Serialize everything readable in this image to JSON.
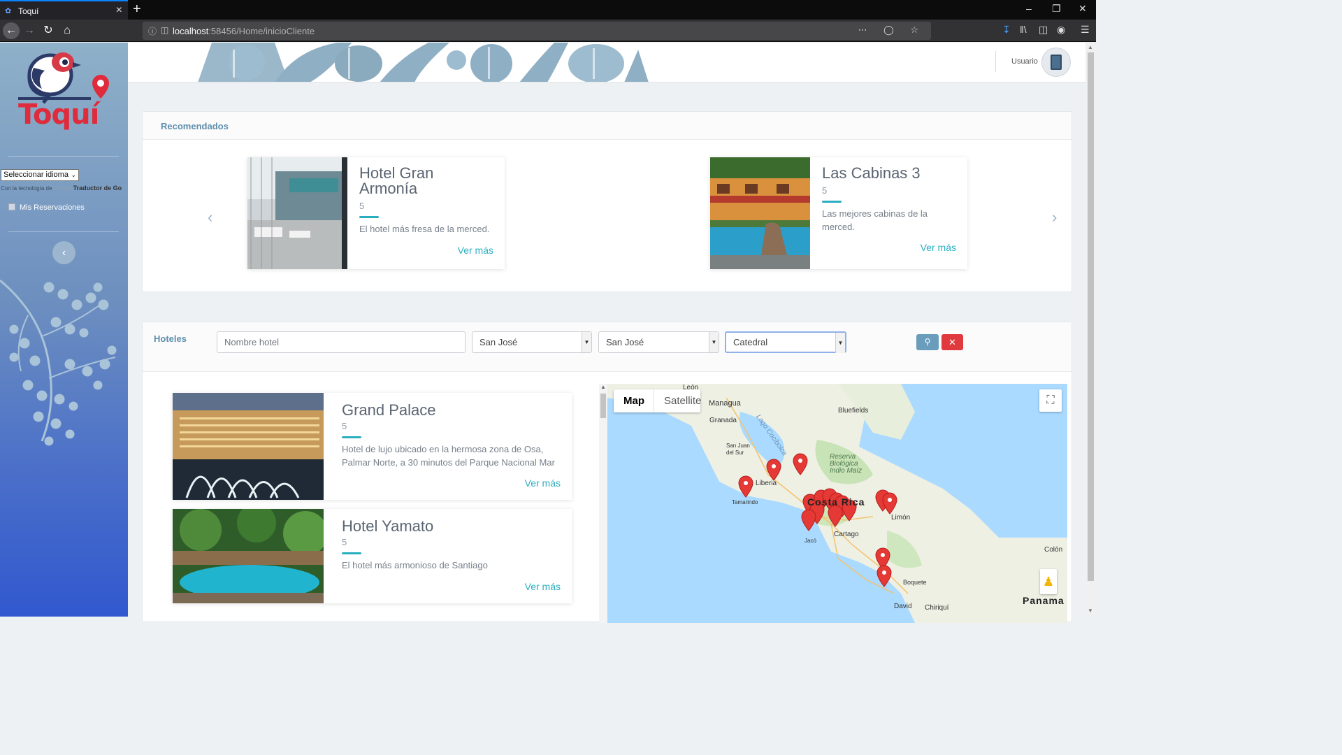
{
  "browser": {
    "tab_title": "Toquí",
    "url_host": "localhost",
    "url_rest": ":58456/Home/inicioCliente"
  },
  "sidebar": {
    "logo_text": "Toquí",
    "language_select": "Seleccionar idioma",
    "powered_prefix": "Con la tecnología de",
    "powered_google": "Google",
    "powered_suffix": "Traductor de Go",
    "menu_item": "Mis Reservaciones"
  },
  "header": {
    "user_label": "Usuario"
  },
  "recommended": {
    "title": "Recomendados",
    "items": [
      {
        "name_line1": "Hotel Gran",
        "name_line2": "Armonía",
        "rating": "5",
        "description": "El hotel más fresa de la merced.",
        "link": "Ver más"
      },
      {
        "name_line1": "Las Cabinas 3",
        "rating": "5",
        "description_line1": "Las mejores cabinas de la",
        "description_line2": "merced.",
        "link": "Ver más"
      }
    ]
  },
  "hotels": {
    "title": "Hoteles",
    "filters": {
      "name_placeholder": "Nombre hotel",
      "province": "San José",
      "canton": "San José",
      "district": "Catedral"
    },
    "items": [
      {
        "name": "Grand Palace",
        "rating": "5",
        "description_line1": "Hotel de lujo ubicado en la hermosa zona de Osa,",
        "description_line2": "Palmar Norte, a 30 minutos del Parque Nacional Mar",
        "link": "Ver más"
      },
      {
        "name": "Hotel Yamato",
        "rating": "5",
        "description": "El hotel más armonioso de Santiago",
        "link": "Ver más"
      }
    ]
  },
  "map": {
    "tab_map": "Map",
    "tab_satellite": "Satellite",
    "labels": {
      "leon": "León",
      "managua": "Managua",
      "granada": "Granada",
      "lago": "Lago Cocibolca",
      "san_juan": "San Juan del Sur",
      "bluefields": "Bluefields",
      "reserva": "Reserva Biológica Indio Maíz",
      "liberia": "Liberia",
      "tamarindo": "Tamarindo",
      "costa_rica": "Costa Rica",
      "cartago": "Cartago",
      "limon": "Limón",
      "jaco": "Jacó",
      "colon": "Colón",
      "boquete": "Boquete",
      "david": "David",
      "chiriqui": "Chiriquí",
      "panama": "Panama"
    }
  },
  "colors": {
    "accent": "#2aaec0",
    "section_title": "#5f8fad",
    "clear_button": "#e03a3f",
    "search_button": "#6a9dbb",
    "marker": "#e53935"
  }
}
